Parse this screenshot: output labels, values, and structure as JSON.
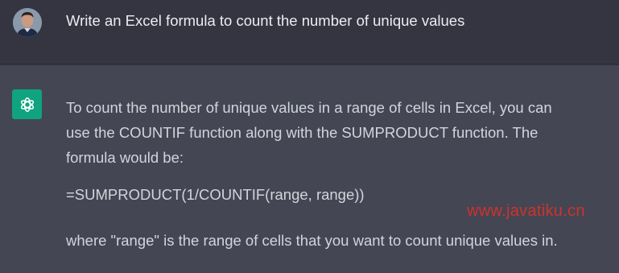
{
  "user_message": {
    "text": "Write an Excel formula to count the number of unique values",
    "avatar_icon": "user-avatar"
  },
  "assistant_message": {
    "icon": "chatgpt-logo-icon",
    "accent_color": "#10a37f",
    "lines": [
      "To count the number of unique values in a range of cells in Excel, you can",
      "use the COUNTIF function along with the SUMPRODUCT function. The",
      "formula would be:"
    ],
    "formula": "=SUMPRODUCT(1/COUNTIF(range, range))",
    "explanation": "where \"range\" is the range of cells that you want to count unique values in."
  },
  "watermark": {
    "text": "www.javatiku.cn",
    "color": "#d0322a"
  }
}
